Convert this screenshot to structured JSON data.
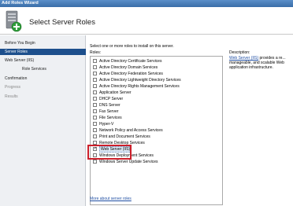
{
  "window": {
    "title": "Add Roles Wizard"
  },
  "header": {
    "title": "Select Server Roles"
  },
  "sidebar": {
    "items": [
      {
        "label": "Before You Begin",
        "state": "normal",
        "sub": false
      },
      {
        "label": "Server Roles",
        "state": "active",
        "sub": false
      },
      {
        "label": "Web Server (IIS)",
        "state": "normal",
        "sub": false
      },
      {
        "label": "Role Services",
        "state": "normal",
        "sub": true
      },
      {
        "label": "Confirmation",
        "state": "normal",
        "sub": false
      },
      {
        "label": "Progress",
        "state": "disabled",
        "sub": false
      },
      {
        "label": "Results",
        "state": "disabled",
        "sub": false
      }
    ]
  },
  "main": {
    "instruction": "Select one or more roles to install on this server.",
    "roles_label": "Roles:",
    "roles": [
      {
        "label": "Active Directory Certificate Services",
        "checked": false
      },
      {
        "label": "Active Directory Domain Services",
        "checked": false
      },
      {
        "label": "Active Directory Federation Services",
        "checked": false
      },
      {
        "label": "Active Directory Lightweight Directory Services",
        "checked": false
      },
      {
        "label": "Active Directory Rights Management Services",
        "checked": false
      },
      {
        "label": "Application Server",
        "checked": false
      },
      {
        "label": "DHCP Server",
        "checked": false
      },
      {
        "label": "DNS Server",
        "checked": false
      },
      {
        "label": "Fax Server",
        "checked": false
      },
      {
        "label": "File Services",
        "checked": false
      },
      {
        "label": "Hyper-V",
        "checked": false
      },
      {
        "label": "Network Policy and Access Services",
        "checked": false
      },
      {
        "label": "Print and Document Services",
        "checked": false
      },
      {
        "label": "Remote Desktop Services",
        "checked": false
      },
      {
        "label": "Web Server (IIS)",
        "checked": true,
        "selected": true
      },
      {
        "label": "Windows Deployment Services",
        "checked": false
      },
      {
        "label": "Windows Server Update Services",
        "checked": false
      }
    ],
    "more_link": "More about server roles"
  },
  "description": {
    "label": "Description:",
    "link_text": "Web Server (IIS)",
    "text": " provides a re... manageable, and scalable Web application infrastructure."
  },
  "colors": {
    "accent": "#1d4f8c",
    "highlight": "#cc1f2a",
    "link": "#1f4ea3"
  }
}
